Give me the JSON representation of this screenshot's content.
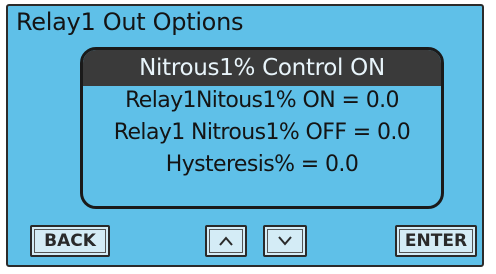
{
  "screen": {
    "title": "Relay1 Out Options"
  },
  "panel": {
    "header": "Nitrous1% Control ON",
    "rows": [
      "Relay1Nitous1% ON = 0.0",
      "Relay1 Nitrous1% OFF = 0.0",
      "Hysteresis% = 0.0"
    ]
  },
  "buttons": {
    "back": "BACK",
    "up_icon": "up-arrow-icon",
    "down_icon": "down-arrow-icon",
    "enter": "ENTER"
  },
  "colors": {
    "screen_bg": "#5fc0e8",
    "header_bg": "#3a3a3a",
    "button_bg": "#d4ecf6"
  }
}
